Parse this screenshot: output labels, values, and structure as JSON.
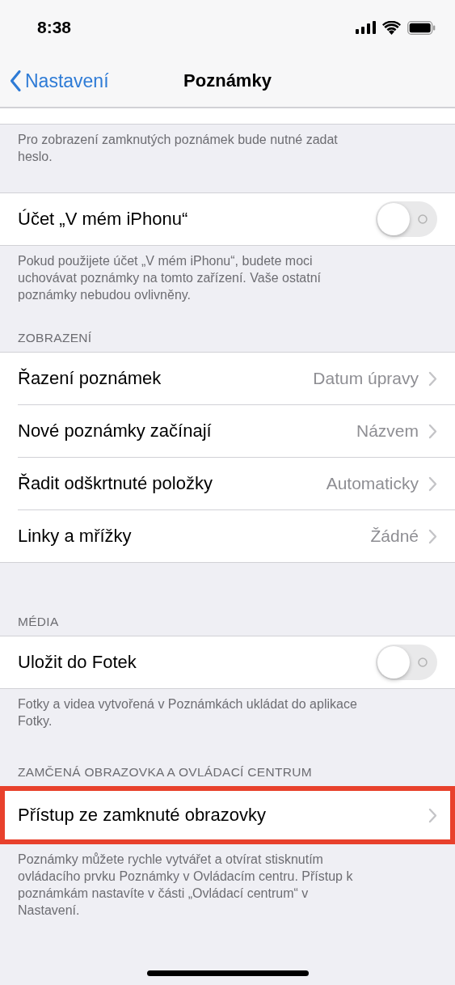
{
  "status_bar": {
    "time": "8:38"
  },
  "nav": {
    "back": "Nastavení",
    "title": "Poznámky"
  },
  "sections": [
    {
      "rows": [
        {
          "kind": "blank"
        }
      ],
      "footer": "Pro zobrazení zamknutých poznámek bude nutné zadat heslo.",
      "highlighted": false
    },
    {
      "rows": [
        {
          "kind": "toggle",
          "label": "Účet „V mém iPhonu“",
          "on": false
        }
      ],
      "footer": "Pokud použijete účet „V mém iPhonu“, budete moci uchovávat poznámky na tomto zařízení. Vaše ostatní poznámky nebudou ovlivněny.",
      "highlighted": false
    },
    {
      "header": "ZOBRAZENÍ",
      "rows": [
        {
          "kind": "link",
          "label": "Řazení poznámek",
          "value": "Datum úpravy"
        },
        {
          "kind": "link",
          "label": "Nové poznámky začínají",
          "value": "Názvem"
        },
        {
          "kind": "link",
          "label": "Řadit odškrtnuté položky",
          "value": "Automaticky"
        },
        {
          "kind": "link",
          "label": "Linky a mřížky",
          "value": "Žádné"
        }
      ],
      "highlighted": false
    },
    {
      "header": "MÉDIA",
      "rows": [
        {
          "kind": "toggle",
          "label": "Uložit do Fotek",
          "on": false
        }
      ],
      "footer": "Fotky a videa vytvořená v Poznámkách ukládat do aplikace Fotky.",
      "highlighted": false
    },
    {
      "header": "ZAMČENÁ OBRAZOVKA A OVLÁDACÍ CENTRUM",
      "rows": [
        {
          "kind": "link",
          "label": "Přístup ze zamknuté obrazovky"
        }
      ],
      "footer": "Poznámky můžete rychle vytvářet a otvírat stisknutím ovládacího prvku Poznámky v Ovládacím centru. Přístup k poznámkám nastavíte v části „Ovládací centrum“ v Nastavení.",
      "highlighted": true
    }
  ]
}
